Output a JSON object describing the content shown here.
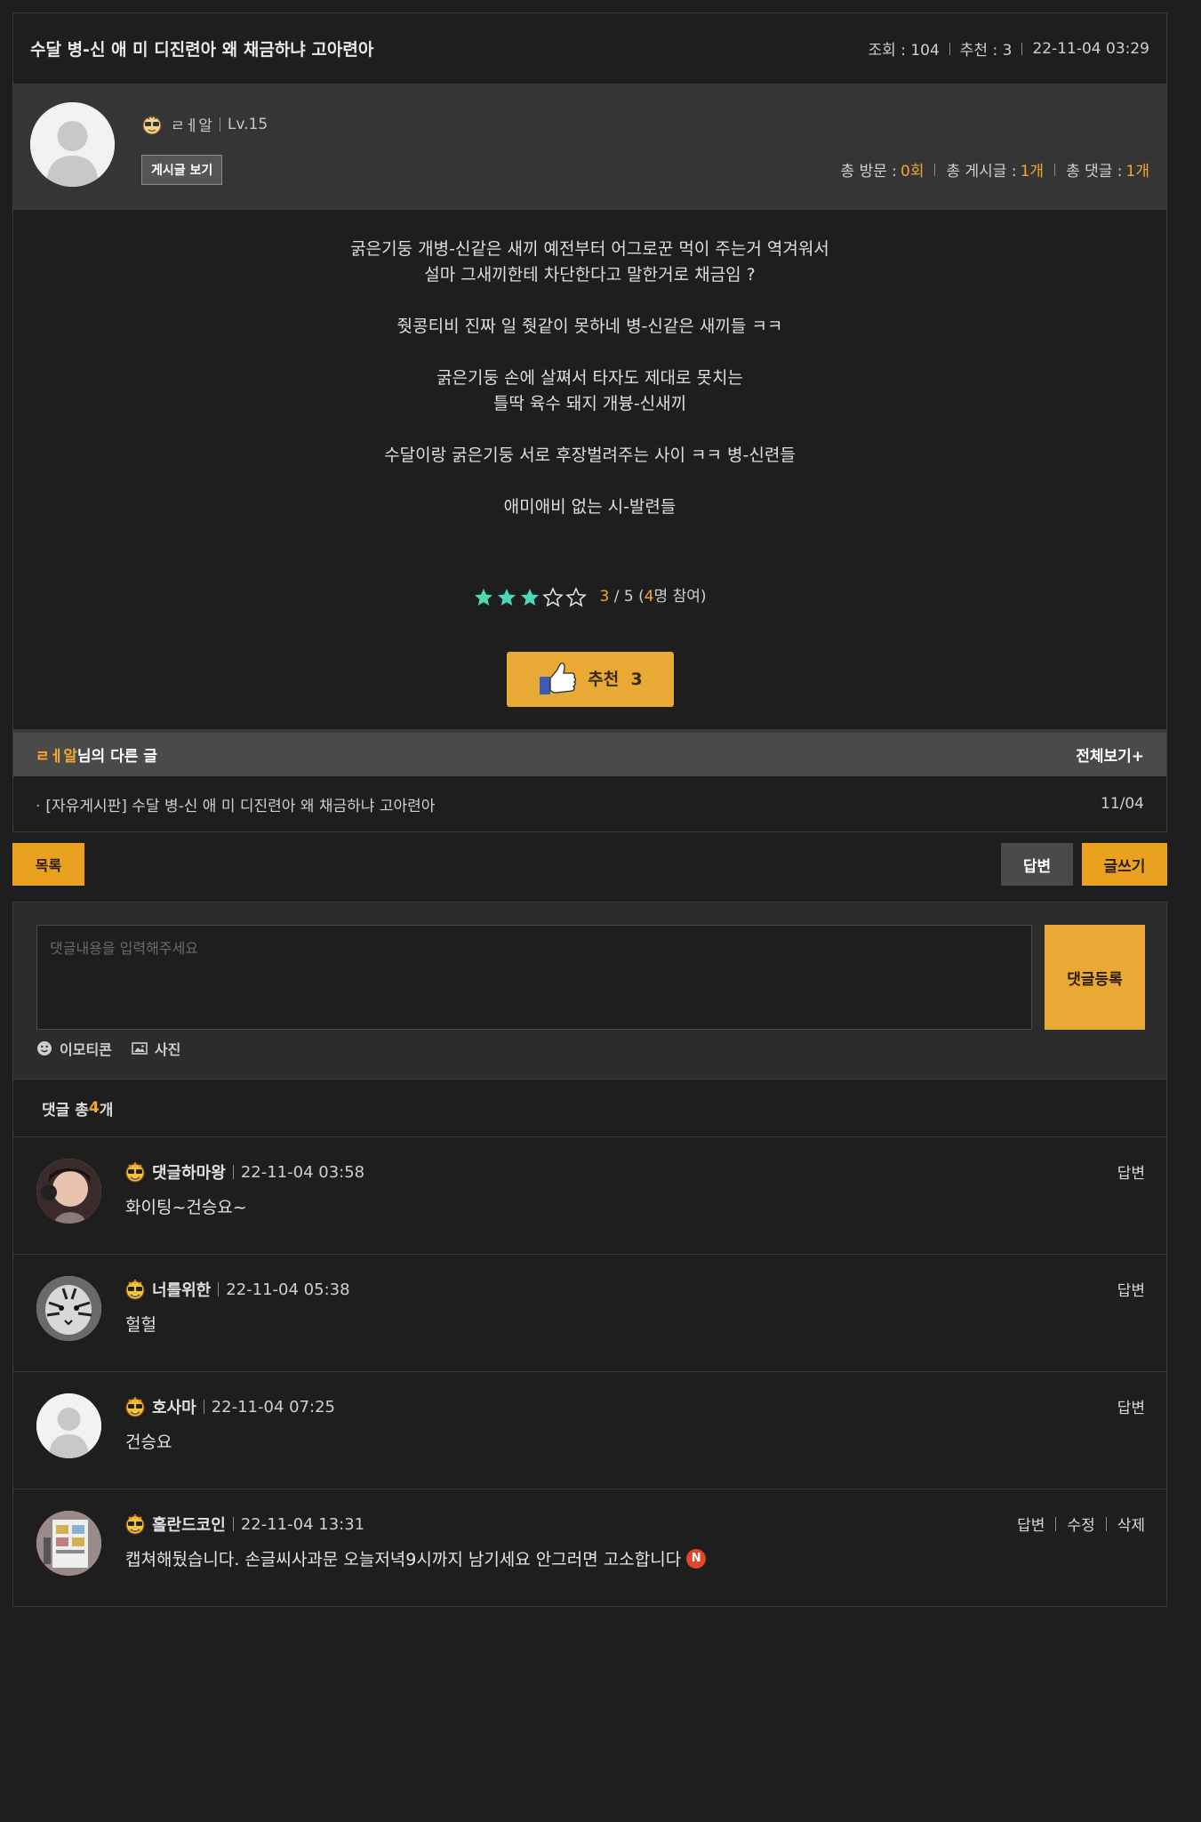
{
  "post": {
    "title": "수달 병-신 애 미 디진련아 왜 채금하냐 고아련아",
    "views_label": "조회 : 104",
    "recommend_label": "추천 : 3",
    "datetime": "22-11-04 03:29"
  },
  "author": {
    "name": "ㄹㅔ알",
    "level": "Lv.15",
    "posts_button": "게시글 보기",
    "visits_label": "총 방문 :",
    "visits_value": "0회",
    "posts_label": "총 게시글 :",
    "posts_value": "1개",
    "comments_label": "총 댓글 :",
    "comments_value": "1개"
  },
  "body": {
    "paragraphs": [
      [
        "굵은기둥 개병-신같은 새끼 예전부터 어그로꾼 먹이 주는거 역겨워서",
        "설마 그새끼한테 차단한다고 말한거로 채금임 ?"
      ],
      [
        "줫콩티비 진짜 일 줫같이 못하네 병-신같은 새끼들 ㅋㅋ"
      ],
      [
        "굵은기둥 손에 살쪄서 타자도 제대로 못치는",
        "틀딱 육수 돼지 개븅-신새끼"
      ],
      [
        "수달이랑 굵은기둥 서로 후장벌려주는 사이 ㅋㅋ 병-신련들"
      ],
      [
        "애미애비 없는 시-발련들"
      ]
    ]
  },
  "rating": {
    "stars_filled": 3,
    "stars_total": 5,
    "score": "3",
    "max_label": " / 5 (",
    "participants": "4",
    "participants_suffix": "명 참여)",
    "star_color": "#4fd8b8"
  },
  "recommend": {
    "label": "추천",
    "count": "3"
  },
  "other_posts": {
    "name": "ㄹㅔ알",
    "suffix": "님의 다른 글",
    "view_all": "전체보기+",
    "items": [
      {
        "board": "[자유게시판]",
        "title": "수달 병-신 애 미 디진련아 왜 채금하냐 고아련아",
        "date": "11/04"
      }
    ]
  },
  "buttons": {
    "list": "목록",
    "reply": "답변",
    "write": "글쓰기"
  },
  "comment_form": {
    "placeholder": "댓글내용을 입력해주세요",
    "submit": "댓글등록",
    "emoticon": "이모티콘",
    "photo": "사진"
  },
  "comments_summary": {
    "prefix": "댓글 총 ",
    "count": "4",
    "suffix": "개"
  },
  "comments": [
    {
      "name": "댓글하마왕",
      "date": "22-11-04 03:58",
      "text": "화이팅~건승요~",
      "actions": [
        "답변"
      ],
      "avatar": "photo-girl",
      "new": false
    },
    {
      "name": "너를위한",
      "date": "22-11-04 05:38",
      "text": "헐헐",
      "actions": [
        "답변"
      ],
      "avatar": "photo-tiger",
      "new": false
    },
    {
      "name": "호사마",
      "date": "22-11-04 07:25",
      "text": "건승요",
      "actions": [
        "답변"
      ],
      "avatar": "default",
      "new": false
    },
    {
      "name": "홀란드코인",
      "date": "22-11-04 13:31",
      "text": "캡쳐해뒀습니다. 손글씨사과문 오늘저녁9시까지 남기세요 안그러면 고소합니다",
      "actions": [
        "답변",
        "수정",
        "삭제"
      ],
      "avatar": "photo-screen",
      "new": true,
      "new_label": "N"
    }
  ],
  "colors": {
    "accent": "#f0a830",
    "button_yellow": "#eaa11f",
    "background": "#1e1e1e",
    "new_badge": "#e0462a"
  }
}
